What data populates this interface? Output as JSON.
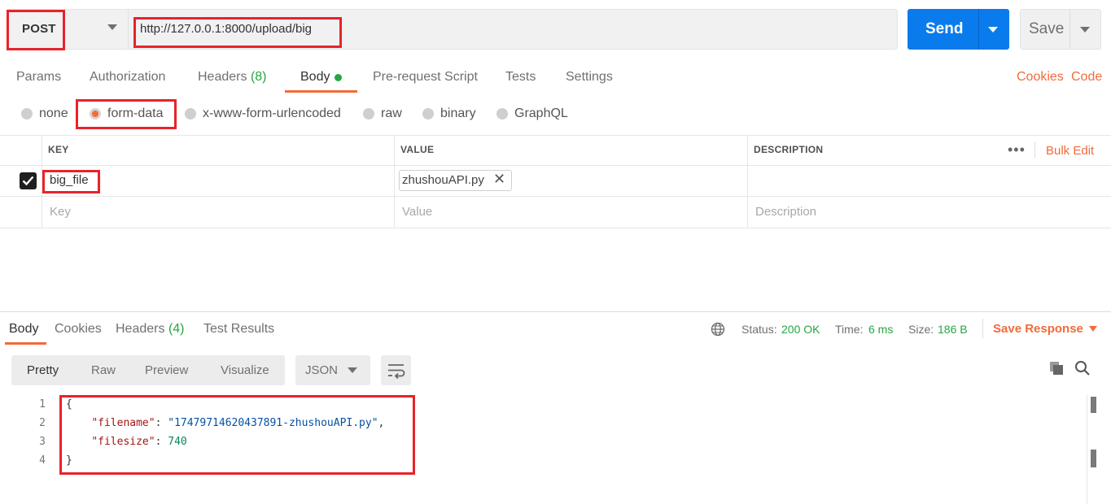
{
  "request": {
    "method": "POST",
    "url": "http://127.0.0.1:8000/upload/big",
    "send_label": "Send",
    "save_label": "Save"
  },
  "tabs": [
    {
      "label": "Params"
    },
    {
      "label": "Authorization"
    },
    {
      "label": "Headers",
      "count": "(8)"
    },
    {
      "label": "Body",
      "active": true
    },
    {
      "label": "Pre-request Script"
    },
    {
      "label": "Tests"
    },
    {
      "label": "Settings"
    }
  ],
  "right_links": {
    "cookies": "Cookies",
    "code": "Code"
  },
  "body_types": [
    {
      "label": "none",
      "selected": false
    },
    {
      "label": "form-data",
      "selected": true
    },
    {
      "label": "x-www-form-urlencoded",
      "selected": false
    },
    {
      "label": "raw",
      "selected": false
    },
    {
      "label": "binary",
      "selected": false
    },
    {
      "label": "GraphQL",
      "selected": false
    }
  ],
  "form_table": {
    "headers": {
      "key": "KEY",
      "value": "VALUE",
      "description": "DESCRIPTION"
    },
    "more_icon": "more-horizontal-icon",
    "bulk_edit": "Bulk Edit",
    "rows": [
      {
        "checked": true,
        "key": "big_file",
        "value": "zhushouAPI.py",
        "description": ""
      }
    ],
    "placeholders": {
      "key": "Key",
      "value": "Value",
      "description": "Description"
    }
  },
  "response": {
    "tabs": [
      {
        "label": "Body",
        "active": true
      },
      {
        "label": "Cookies"
      },
      {
        "label": "Headers",
        "count": "(4)"
      },
      {
        "label": "Test Results"
      }
    ],
    "status_label": "Status:",
    "status_value": "200 OK",
    "time_label": "Time:",
    "time_value": "6 ms",
    "size_label": "Size:",
    "size_value": "186 B",
    "save_response": "Save Response",
    "view_modes": [
      "Pretty",
      "Raw",
      "Preview",
      "Visualize"
    ],
    "active_view": "Pretty",
    "format": "JSON",
    "line_numbers": [
      "1",
      "2",
      "3",
      "4"
    ],
    "json": {
      "open": "{",
      "key1": "\"filename\"",
      "val1": "\"17479714620437891-zhushouAPI.py\"",
      "key2": "\"filesize\"",
      "val2": "740",
      "close": "}"
    }
  },
  "colors": {
    "accent": "#f26b3a",
    "send": "#097bed",
    "success": "#26a541",
    "highlight_box": "#e8232b"
  }
}
